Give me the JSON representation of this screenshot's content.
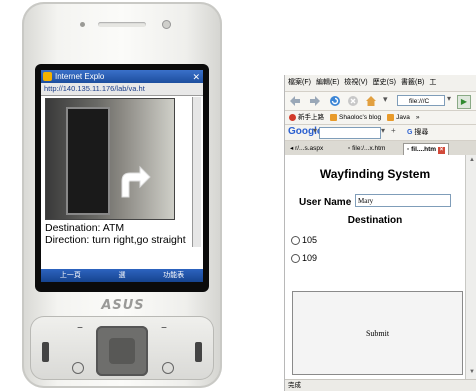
{
  "phone": {
    "brand": "ASUS",
    "browser_title": "Internet Explo",
    "url": "http://140.135.11.176/lab/va.ht",
    "destination_text": "Destination: ATM",
    "direction_text": "Direction: turn right,go straight",
    "softkeys": [
      "上一頁",
      "選",
      "功能表"
    ]
  },
  "browser": {
    "menu": [
      "檔案(F)",
      "編輯(E)",
      "檢視(V)",
      "歷史(S)",
      "書籤(B)",
      "工"
    ],
    "url_value": "file:///C",
    "bookmarks": [
      "新手上路",
      "Shaoloc's blog",
      "Java"
    ],
    "bookmarks_more": "»",
    "google_label": "Google",
    "google_search_btn": "搜尋",
    "tabs": [
      {
        "label": "r/...s.aspx"
      },
      {
        "label": "file:/...x.htm"
      },
      {
        "label": "fil....htm"
      }
    ],
    "status": "完成"
  },
  "page": {
    "title": "Wayfinding System",
    "user_label": "User Name",
    "user_value": "Mary",
    "destination_label": "Destination",
    "options": [
      {
        "label": "105",
        "selected": false
      },
      {
        "label": "109",
        "selected": false
      }
    ],
    "submit_label": "Submit"
  }
}
